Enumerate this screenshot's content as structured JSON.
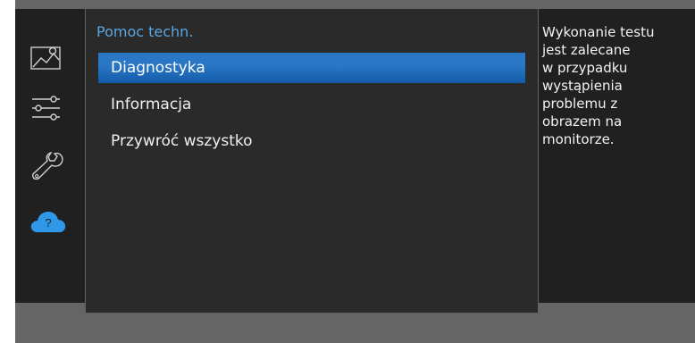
{
  "navigation": {
    "icons": [
      {
        "name": "picture-icon",
        "state": "inactive"
      },
      {
        "name": "settings-sliders-icon",
        "state": "inactive"
      },
      {
        "name": "wrench-icon",
        "state": "inactive"
      },
      {
        "name": "support-help-icon",
        "state": "active",
        "glyph": "?",
        "color": "#2f98e8"
      }
    ]
  },
  "panel": {
    "title": "Pomoc techn.",
    "items": [
      {
        "label": "Diagnostyka",
        "selected": true
      },
      {
        "label": "Informacja",
        "selected": false
      },
      {
        "label": "Przywróć wszystko",
        "selected": false
      }
    ]
  },
  "description": {
    "lines": [
      "Wykonanie testu",
      "jest zalecane",
      "w przypadku",
      "wystąpienia",
      "problemu z",
      "obrazem na",
      "monitorze."
    ]
  }
}
